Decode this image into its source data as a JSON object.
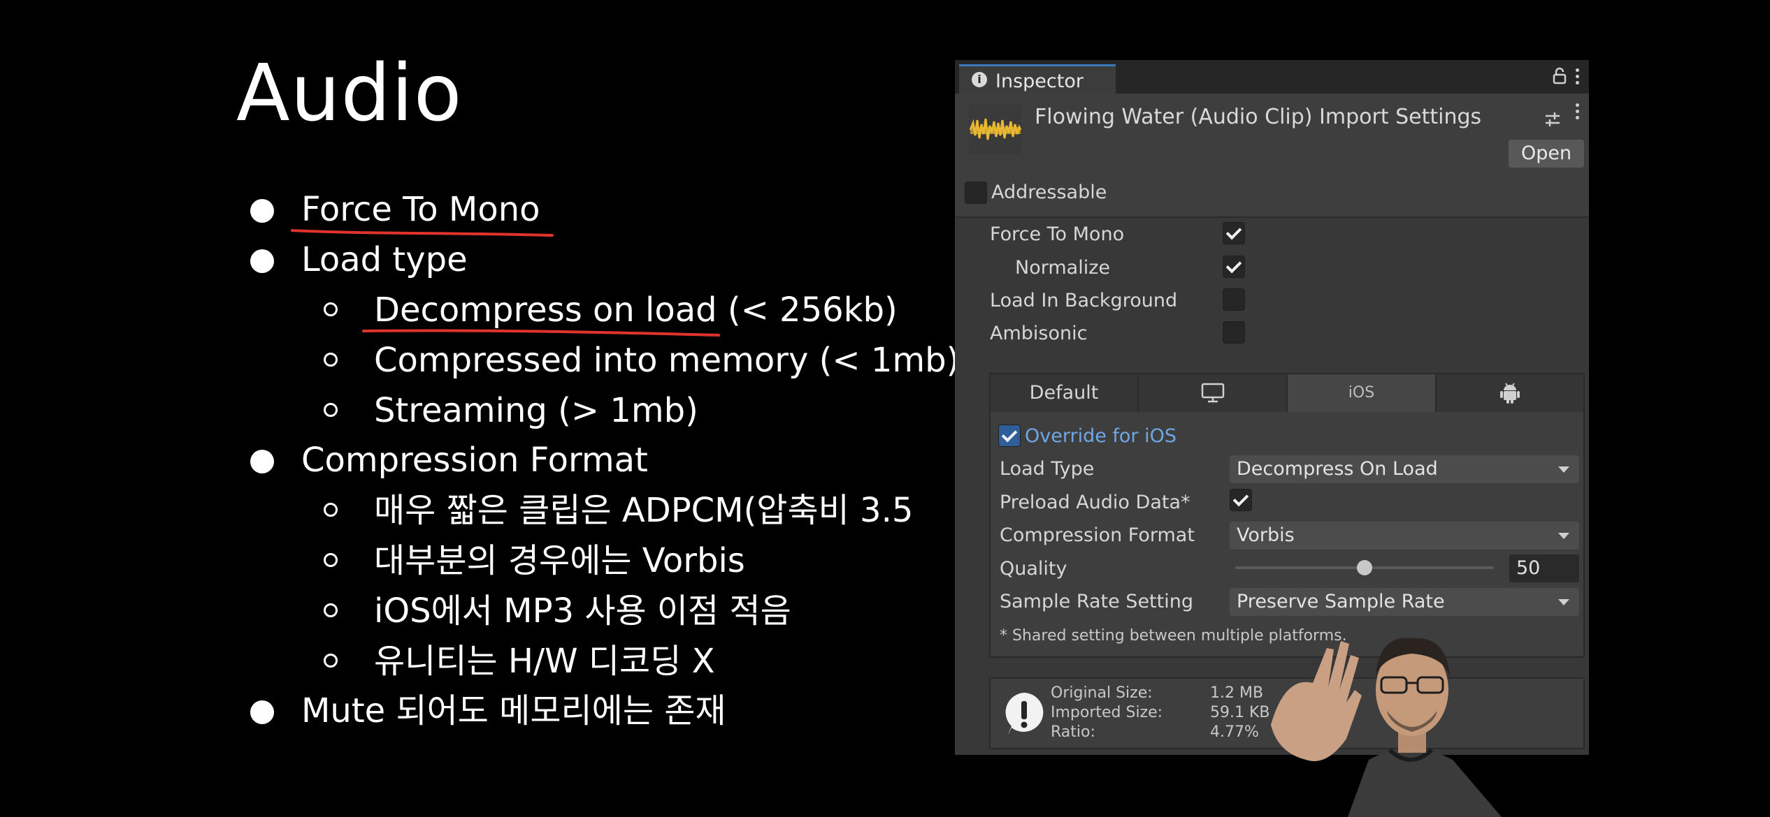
{
  "slide": {
    "title": "Audio",
    "bullets": [
      {
        "text": "Force To Mono",
        "level": 1,
        "underlined": true
      },
      {
        "text": "Load type",
        "level": 1
      },
      {
        "text": "Decompress on load (< 256kb)",
        "level": 2,
        "underlined": true
      },
      {
        "text": "Compressed into memory (< 1mb)",
        "level": 2
      },
      {
        "text": "Streaming (> 1mb)",
        "level": 2
      },
      {
        "text": "Compression Format",
        "level": 1
      },
      {
        "text": "매우 짧은 클립은 ADPCM(압축비 3.5",
        "level": 2
      },
      {
        "text": "대부분의 경우에는 Vorbis",
        "level": 2
      },
      {
        "text": "iOS에서 MP3 사용 이점 적음",
        "level": 2
      },
      {
        "text": "유니티는 H/W 디코딩 X",
        "level": 2
      },
      {
        "text": "Mute 되어도 메모리에는 존재",
        "level": 1
      }
    ],
    "underline_color": "#e0332c"
  },
  "inspector": {
    "tab_label": "Inspector",
    "asset_title": "Flowing Water (Audio Clip) Import Settings",
    "open_label": "Open",
    "addressable_label": "Addressable",
    "addressable_checked": false,
    "options": [
      {
        "label": "Force To Mono",
        "checked": true
      },
      {
        "label": "Normalize",
        "checked": true
      },
      {
        "label": "Load In Background",
        "checked": false
      },
      {
        "label": "Ambisonic",
        "checked": false
      }
    ],
    "platform_tabs": [
      {
        "label": "Default",
        "icon": "text"
      },
      {
        "label": "",
        "icon": "monitor-icon"
      },
      {
        "label": "iOS",
        "icon": "text"
      },
      {
        "label": "",
        "icon": "android-icon"
      }
    ],
    "active_platform": "iOS",
    "override_label": "Override for iOS",
    "override_checked": true,
    "load_type_label": "Load Type",
    "load_type_value": "Decompress On Load",
    "preload_label": "Preload Audio Data*",
    "preload_checked": true,
    "compression_label": "Compression Format",
    "compression_value": "Vorbis",
    "quality_label": "Quality",
    "quality_value": "50",
    "quality_fraction": 0.5,
    "sample_rate_label": "Sample Rate Setting",
    "sample_rate_value": "Preserve Sample Rate",
    "shared_note": "* Shared setting between multiple platforms.",
    "info": {
      "original_label": "Original Size:",
      "original_value": "1.2 MB",
      "imported_label": "Imported Size:",
      "imported_value": "59.1 KB",
      "ratio_label": "Ratio:",
      "ratio_value": "4.77%"
    },
    "accent_color": "#4a8ad6"
  }
}
